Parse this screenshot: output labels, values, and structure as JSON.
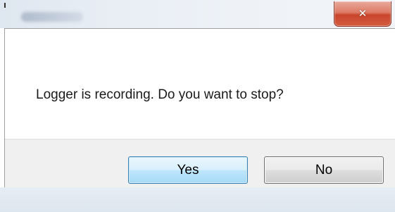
{
  "titlebar": {
    "close_icon_glyph": "✕"
  },
  "dialog": {
    "message": "Logger is recording. Do you want to stop?",
    "yes_label": "Yes",
    "no_label": "No",
    "default_button": "Yes"
  },
  "colors": {
    "close_button_red": "#c9452c",
    "default_button_blue": "#3c7fb1",
    "button_bar_gray": "#f0f0f0"
  }
}
